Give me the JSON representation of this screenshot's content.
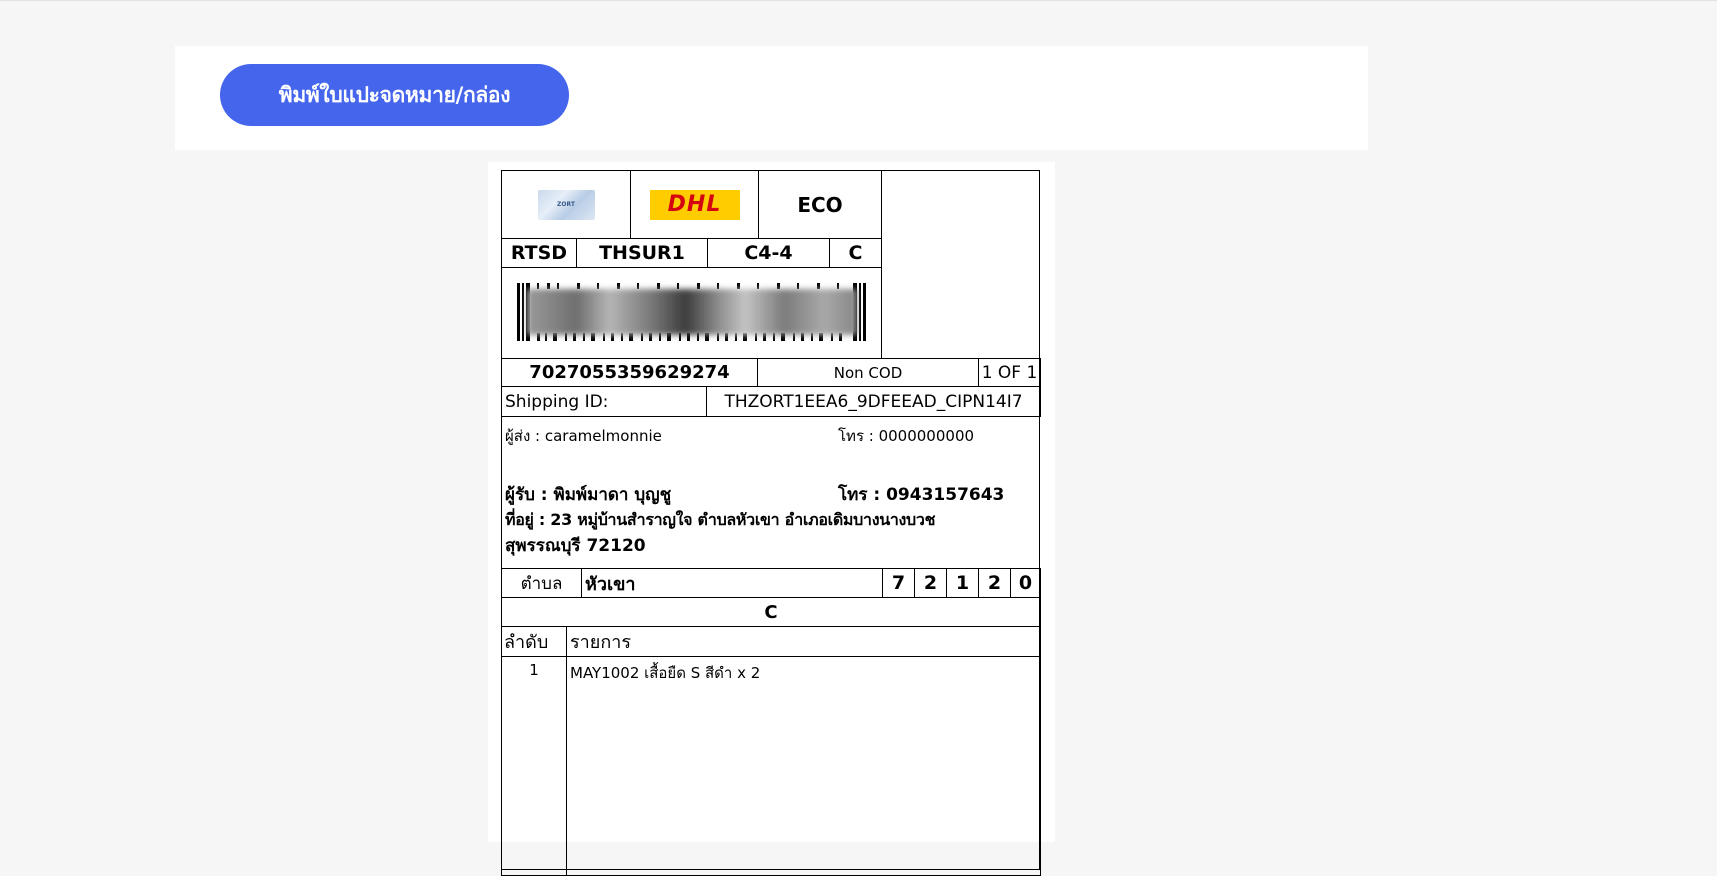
{
  "toolbar": {
    "print_button_label": "พิมพ์ใบแปะจดหมาย/กล่อง"
  },
  "label": {
    "logo_text": "ZORT",
    "carrier_logo_text": "DHL",
    "service": "ECO",
    "route": [
      "RTSD",
      "THSUR1",
      "C4-4",
      "C"
    ],
    "tracking_number": "7027055359629274",
    "cod_status": "Non COD",
    "package_count": "1 OF 1",
    "shipping_id_label": "Shipping ID:",
    "shipping_id": "THZORT1EEA6_9DFEEAD_CIPN14I7",
    "sender": {
      "name": "ผู้ส่ง : caramelmonnie",
      "phone": "โทร : 0000000000"
    },
    "recipient": {
      "name": "ผู้รับ : พิมพ์มาดา บุญชู",
      "phone": "โทร : 0943157643",
      "address_line1": "ที่อยู่ : 23 หมู่บ้านสำราญใจ ตำบลหัวเขา อำเภอเดิมบางนางบวช",
      "address_line2": "สุพรรณบุรี 72120"
    },
    "subdistrict_label": "ตำบล",
    "subdistrict": "หัวเขา",
    "postcode_digits": [
      "7",
      "2",
      "1",
      "2",
      "0"
    ],
    "sort_code": "C",
    "items_header": {
      "no": "ลำดับ",
      "item": "รายการ"
    },
    "items": [
      {
        "no": "1",
        "description": "MAY1002 เสื้อยืด S สีดำ x 2"
      }
    ]
  }
}
